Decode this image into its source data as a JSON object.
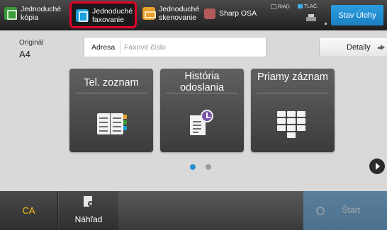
{
  "tabs": [
    {
      "label_line1": "Jednoduché",
      "label_line2": "kópia",
      "icon": "copy-icon",
      "color": "#3a9b3a"
    },
    {
      "label_line1": "Jednoduché",
      "label_line2": "faxovanie",
      "icon": "fax-icon",
      "color": "#1aa0d8",
      "selected": true
    },
    {
      "label_line1": "Jednoduché",
      "label_line2": "skenovanie",
      "icon": "scan-icon",
      "color": "#e8a12a"
    },
    {
      "label_line1": "Sharp OSA",
      "label_line2": "",
      "icon": "osa-icon",
      "color": "#b55b5b"
    }
  ],
  "status": {
    "riad": "RIAD.",
    "tlac": "TLAČ.",
    "job_status_label": "Stav Úlohy"
  },
  "original": {
    "label": "Originál",
    "value": "A4"
  },
  "address": {
    "label": "Adresa",
    "placeholder": "Faxové číslo",
    "value": ""
  },
  "details_label": "Detaily",
  "tiles": [
    {
      "title": "Tel. zoznam",
      "icon": "address-book-icon"
    },
    {
      "title_line1": "História",
      "title_line2": "odoslania",
      "icon": "history-icon"
    },
    {
      "title": "Priamy záznam",
      "icon": "keypad-icon"
    }
  ],
  "pager": {
    "current": 1,
    "total": 2
  },
  "bottom": {
    "ca_label": "CA",
    "preview_label": "Náhľad",
    "start_label": "Štart"
  },
  "colors": {
    "selection_outline": "#e4002b",
    "accent_blue": "#1d7fc2",
    "ca_text": "#f5c518"
  }
}
